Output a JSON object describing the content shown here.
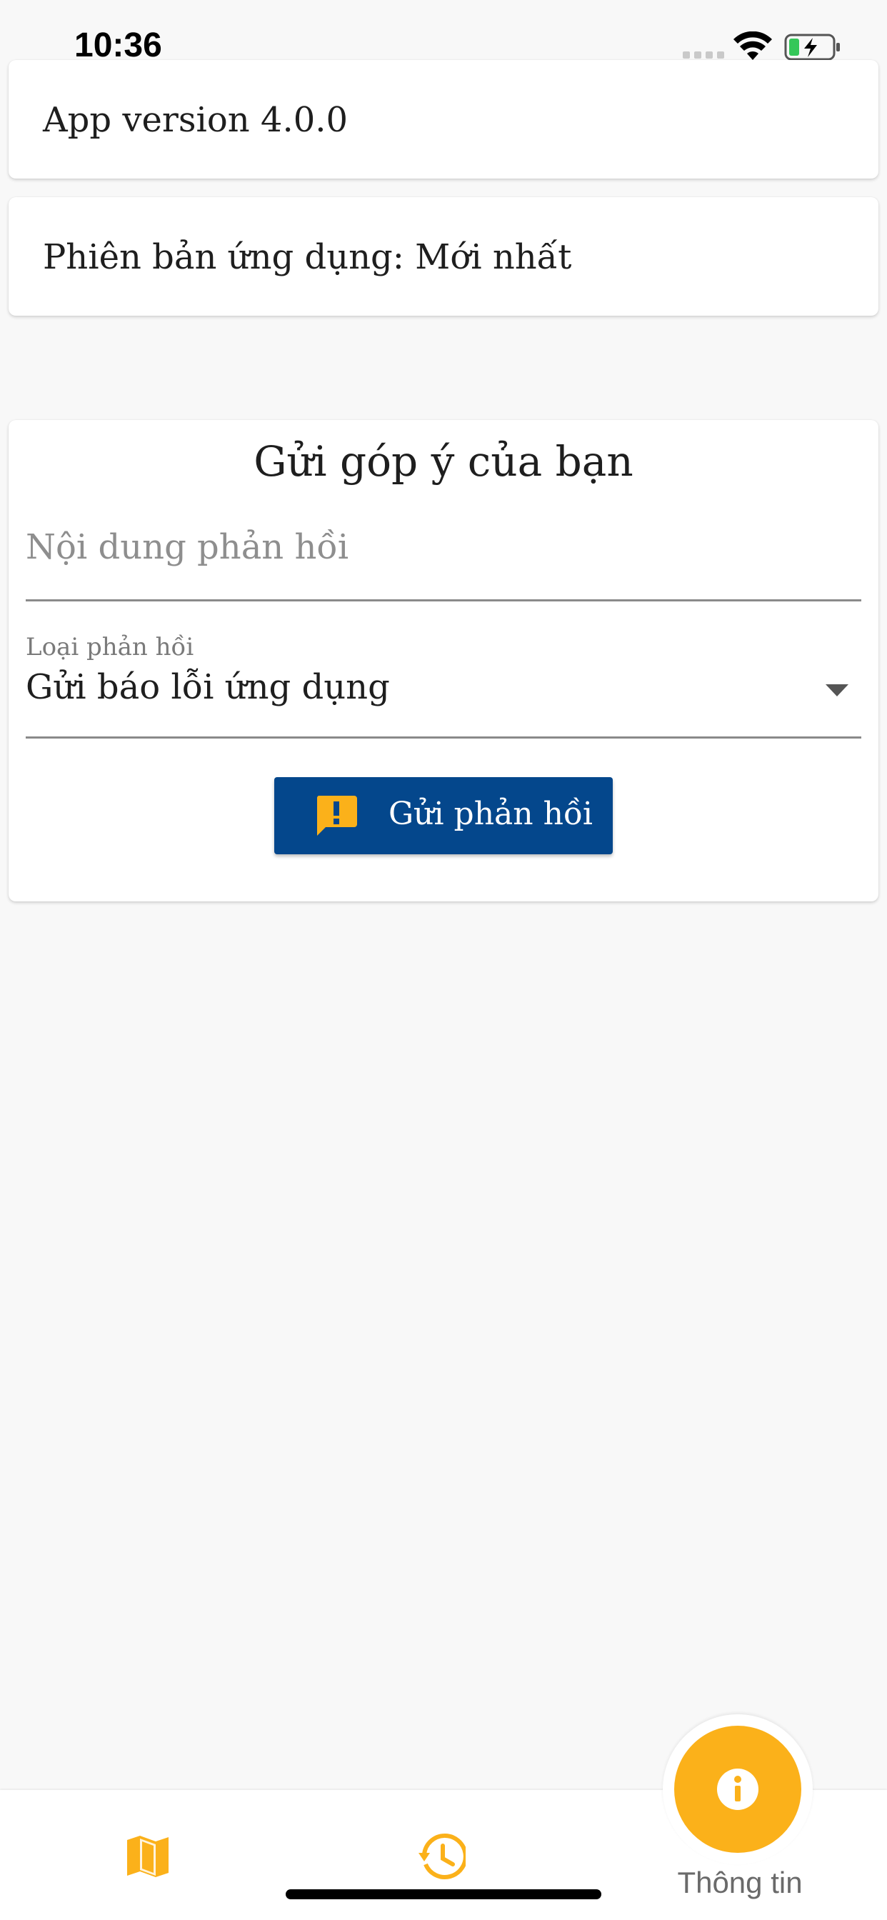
{
  "status_bar": {
    "time": "10:36"
  },
  "info": {
    "app_version": "App version 4.0.0",
    "version_status": "Phiên bản ứng dụng: Mới nhất"
  },
  "feedback": {
    "title": "Gửi góp ý của bạn",
    "content_placeholder": "Nội dung phản hồi",
    "type_label": "Loại phản hồi",
    "type_value": "Gửi báo lỗi ứng dụng",
    "submit_label": "Gửi phản hồi"
  },
  "nav": {
    "info_label": "Thông tin"
  },
  "colors": {
    "accent": "#fbb11a",
    "primary": "#04478c",
    "background": "#f8f8f8"
  },
  "icons": {
    "map": "map-icon",
    "history": "history-icon",
    "info": "info-icon",
    "feedback": "feedback-icon",
    "dropdown": "chevron-down-icon"
  }
}
